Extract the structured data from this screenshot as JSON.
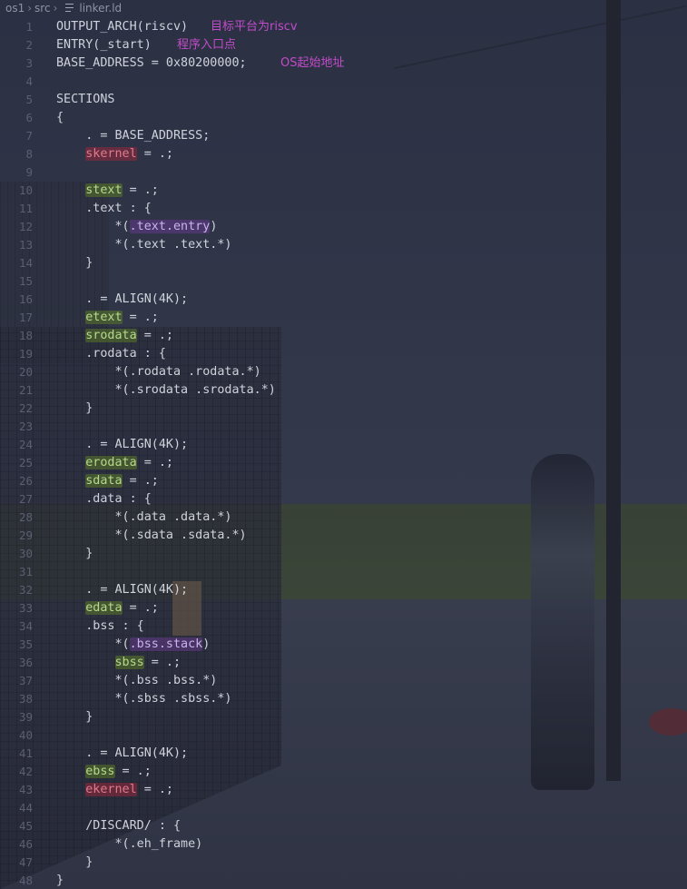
{
  "breadcrumb": {
    "root": "os1",
    "folder": "src",
    "file": "linker.ld"
  },
  "comments": {
    "arch": "目标平台为riscv",
    "entry": "程序入口点",
    "base": "OS起始地址"
  },
  "lines": [
    {
      "n": "1",
      "t": "OUTPUT_ARCH(riscv)"
    },
    {
      "n": "2",
      "t": "ENTRY(_start)"
    },
    {
      "n": "3",
      "t": "BASE_ADDRESS = 0x80200000;"
    },
    {
      "n": "4",
      "t": ""
    },
    {
      "n": "5",
      "t": "SECTIONS"
    },
    {
      "n": "6",
      "t": "{"
    },
    {
      "n": "7",
      "t": "    . = BASE_ADDRESS;"
    },
    {
      "n": "8",
      "pre": "    ",
      "hl": "skernel",
      "post": " = .;",
      "kind": "red"
    },
    {
      "n": "9",
      "t": ""
    },
    {
      "n": "10",
      "pre": "    ",
      "hl": "stext",
      "post": " = .;",
      "kind": "green"
    },
    {
      "n": "11",
      "t": "    .text : {"
    },
    {
      "n": "12",
      "pre": "        *(",
      "hl": ".text.entry",
      "post": ")",
      "kind": "purple"
    },
    {
      "n": "13",
      "t": "        *(.text .text.*)"
    },
    {
      "n": "14",
      "t": "    }"
    },
    {
      "n": "15",
      "t": ""
    },
    {
      "n": "16",
      "t": "    . = ALIGN(4K);"
    },
    {
      "n": "17",
      "pre": "    ",
      "hl": "etext",
      "post": " = .;",
      "kind": "green"
    },
    {
      "n": "18",
      "pre": "    ",
      "hl": "srodata",
      "post": " = .;",
      "kind": "green"
    },
    {
      "n": "19",
      "t": "    .rodata : {"
    },
    {
      "n": "20",
      "t": "        *(.rodata .rodata.*)"
    },
    {
      "n": "21",
      "t": "        *(.srodata .srodata.*)"
    },
    {
      "n": "22",
      "t": "    }"
    },
    {
      "n": "23",
      "t": ""
    },
    {
      "n": "24",
      "t": "    . = ALIGN(4K);"
    },
    {
      "n": "25",
      "pre": "    ",
      "hl": "erodata",
      "post": " = .;",
      "kind": "green"
    },
    {
      "n": "26",
      "pre": "    ",
      "hl": "sdata",
      "post": " = .;",
      "kind": "green"
    },
    {
      "n": "27",
      "t": "    .data : {"
    },
    {
      "n": "28",
      "t": "        *(.data .data.*)"
    },
    {
      "n": "29",
      "t": "        *(.sdata .sdata.*)"
    },
    {
      "n": "30",
      "t": "    }"
    },
    {
      "n": "31",
      "t": ""
    },
    {
      "n": "32",
      "t": "    . = ALIGN(4K);"
    },
    {
      "n": "33",
      "pre": "    ",
      "hl": "edata",
      "post": " = .;",
      "kind": "green"
    },
    {
      "n": "34",
      "t": "    .bss : {"
    },
    {
      "n": "35",
      "pre": "        *(",
      "hl": ".bss.stack",
      "post": ")",
      "kind": "purple"
    },
    {
      "n": "36",
      "pre": "        ",
      "hl": "sbss",
      "post": " = .;",
      "kind": "green"
    },
    {
      "n": "37",
      "t": "        *(.bss .bss.*)"
    },
    {
      "n": "38",
      "t": "        *(.sbss .sbss.*)"
    },
    {
      "n": "39",
      "t": "    }"
    },
    {
      "n": "40",
      "t": ""
    },
    {
      "n": "41",
      "t": "    . = ALIGN(4K);"
    },
    {
      "n": "42",
      "pre": "    ",
      "hl": "ebss",
      "post": " = .;",
      "kind": "green"
    },
    {
      "n": "43",
      "pre": "    ",
      "hl": "ekernel",
      "post": " = .;",
      "kind": "red"
    },
    {
      "n": "44",
      "t": ""
    },
    {
      "n": "45",
      "t": "    /DISCARD/ : {"
    },
    {
      "n": "46",
      "t": "        *(.eh_frame)"
    },
    {
      "n": "47",
      "t": "    }"
    },
    {
      "n": "48",
      "t": "}"
    }
  ],
  "colors": {
    "comment": "#c24cc9",
    "highlight_red": "#e07a8c",
    "highlight_green": "#b6d98a",
    "highlight_purple": "#c9b3ee"
  }
}
